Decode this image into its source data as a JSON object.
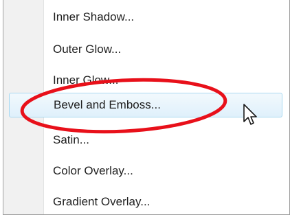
{
  "menu": {
    "items": [
      {
        "label": "Inner Shadow..."
      },
      {
        "label": "Outer Glow..."
      },
      {
        "label": "Inner Glow..."
      },
      {
        "label": "Bevel and Emboss...",
        "highlighted": true
      },
      {
        "label": "Satin..."
      },
      {
        "label": "Color Overlay..."
      },
      {
        "label": "Gradient Overlay..."
      }
    ]
  },
  "colors": {
    "annotation_ring": "#e8101a",
    "highlight_border": "#a8d8f0",
    "highlight_fill": "#e6f4fc",
    "gutter": "#f1f1f1"
  },
  "icons": {
    "cursor": "mouse-pointer-icon",
    "annotation": "red-ellipse-annotation"
  }
}
